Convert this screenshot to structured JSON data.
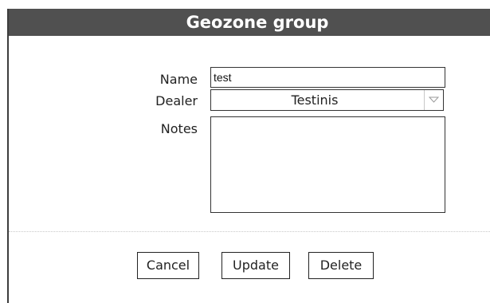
{
  "dialog": {
    "title": "Geozone group"
  },
  "form": {
    "name_label": "Name",
    "name_value": "test",
    "dealer_label": "Dealer",
    "dealer_value": "Testinis",
    "notes_label": "Notes",
    "notes_value": ""
  },
  "buttons": {
    "cancel_label": "Cancel",
    "update_label": "Update",
    "delete_label": "Delete"
  },
  "icons": {
    "dealer_dropdown": "chevron-down-icon"
  },
  "colors": {
    "titlebar_bg": "#505050",
    "titlebar_text": "#ffffff",
    "border": "#333333"
  }
}
